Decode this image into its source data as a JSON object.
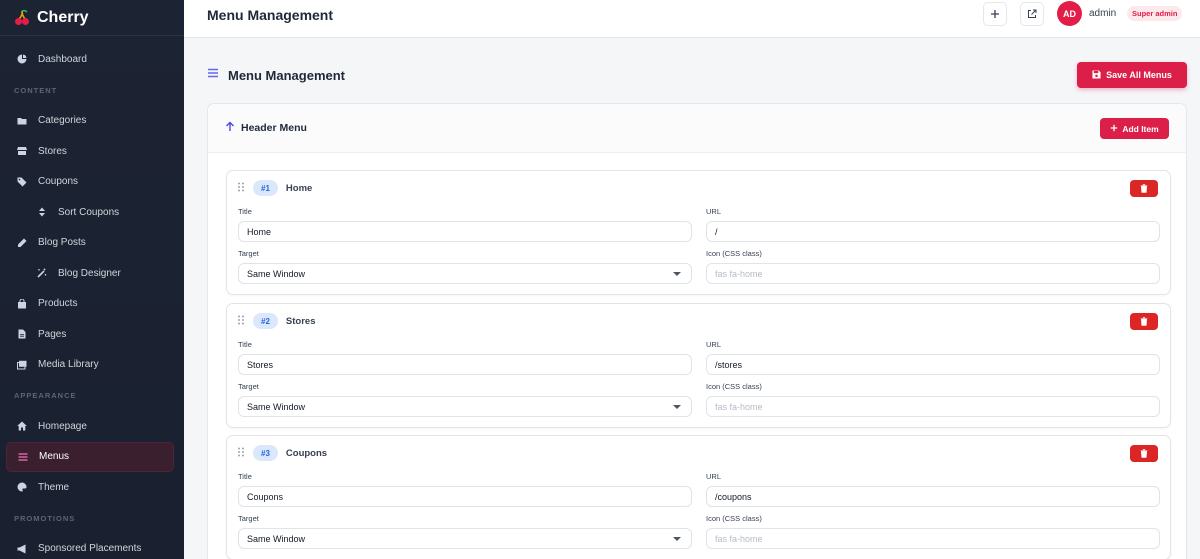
{
  "brand": {
    "name": "Cherry"
  },
  "sidebar": {
    "items": [
      {
        "label": "Dashboard",
        "icon": "dashboard-icon"
      },
      {
        "section": "CONTENT"
      },
      {
        "label": "Categories",
        "icon": "folder-icon"
      },
      {
        "label": "Stores",
        "icon": "store-icon"
      },
      {
        "label": "Coupons",
        "icon": "tags-icon"
      },
      {
        "label": "Sort Coupons",
        "icon": "sort-icon",
        "sub": true
      },
      {
        "label": "Blog Posts",
        "icon": "pen-icon"
      },
      {
        "label": "Blog Designer",
        "icon": "magic-wand-icon",
        "sub": true
      },
      {
        "label": "Products",
        "icon": "bag-icon"
      },
      {
        "label": "Pages",
        "icon": "file-icon"
      },
      {
        "label": "Media Library",
        "icon": "images-icon"
      },
      {
        "section": "APPEARANCE"
      },
      {
        "label": "Homepage",
        "icon": "home-icon"
      },
      {
        "label": "Menus",
        "icon": "bars-icon",
        "active": true
      },
      {
        "label": "Theme",
        "icon": "palette-icon"
      },
      {
        "section": "PROMOTIONS"
      },
      {
        "label": "Sponsored Placements",
        "icon": "megaphone-icon"
      }
    ]
  },
  "topbar": {
    "title": "Menu Management",
    "avatar_initials": "AD",
    "username": "admin",
    "role": "Super admin"
  },
  "main": {
    "title": "Menu Management",
    "save_label": "Save All Menus",
    "panel": {
      "title": "Header Menu",
      "add_label": "Add Item",
      "field_labels": {
        "title": "Title",
        "url": "URL",
        "target": "Target",
        "icon": "Icon (CSS class)"
      },
      "items": [
        {
          "badge": "#1",
          "name": "Home",
          "title": "Home",
          "url": "/",
          "target": "Same Window",
          "icon_placeholder": "fas fa-home"
        },
        {
          "badge": "#2",
          "name": "Stores",
          "title": "Stores",
          "url": "/stores",
          "target": "Same Window",
          "icon_placeholder": "fas fa-home"
        },
        {
          "badge": "#3",
          "name": "Coupons",
          "title": "Coupons",
          "url": "/coupons",
          "target": "Same Window",
          "icon_placeholder": "fas fa-home"
        }
      ]
    }
  },
  "colors": {
    "accent": "#dc1f48",
    "sidebar_bg": "#1c2333",
    "badge_blue": "#2563eb"
  }
}
